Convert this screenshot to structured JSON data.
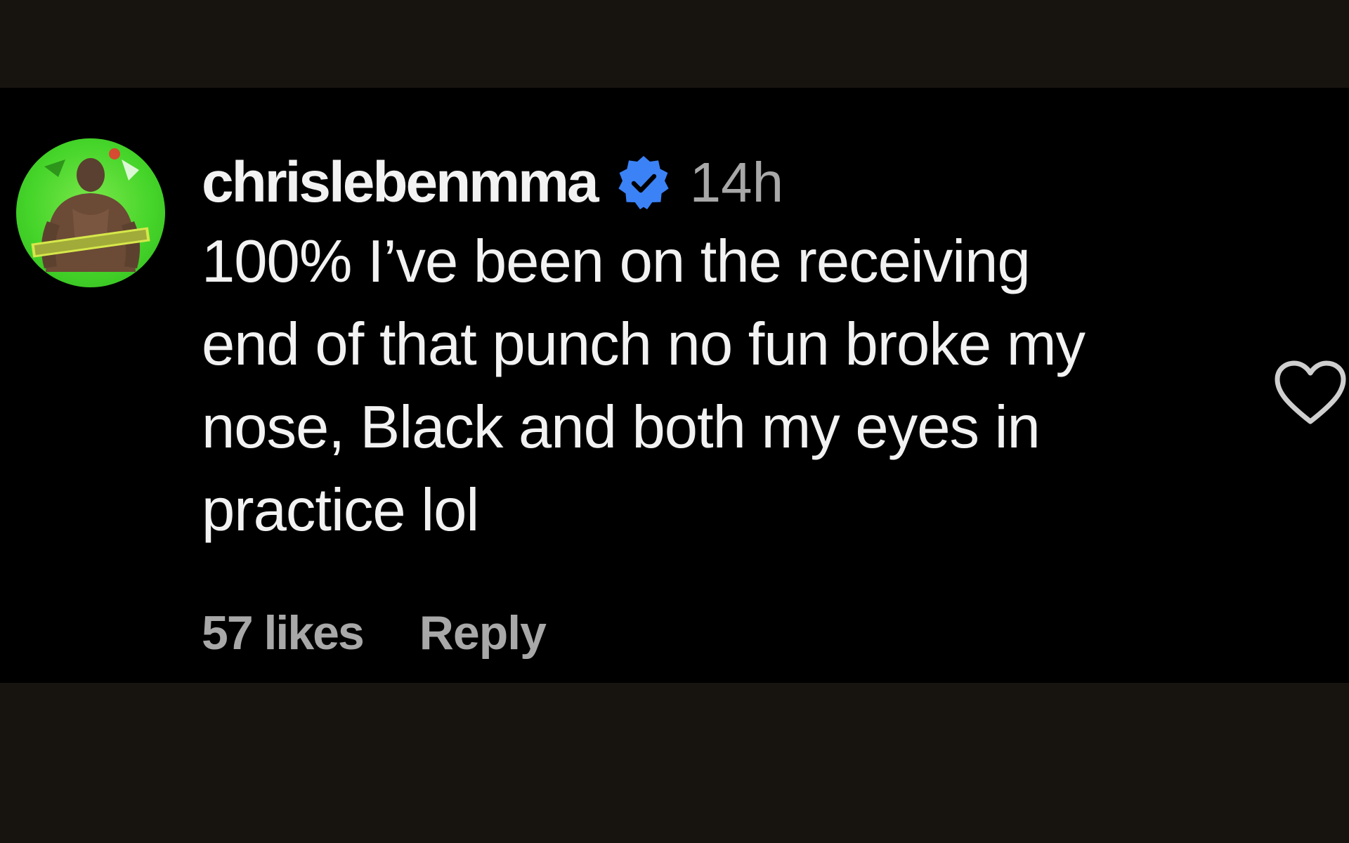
{
  "comment": {
    "username": "chrislebenmma",
    "verified_icon": "verified-badge-icon",
    "timestamp": "14h",
    "text": "100% I’ve been on the receiving\nend of that punch no fun broke my\nnose, Black and both my eyes in\npractice lol",
    "likes": "57 likes",
    "reply_label": "Reply",
    "like_icon": "heart-outline-icon",
    "avatar_icon": "profile-avatar"
  },
  "colors": {
    "panel_background": "#000000",
    "frame_background": "#17130f",
    "primary_text": "#f2f2f2",
    "secondary_text": "#a8a8a8",
    "verified_blue": "#3b82f6",
    "avatar_green": "#46d52a"
  }
}
